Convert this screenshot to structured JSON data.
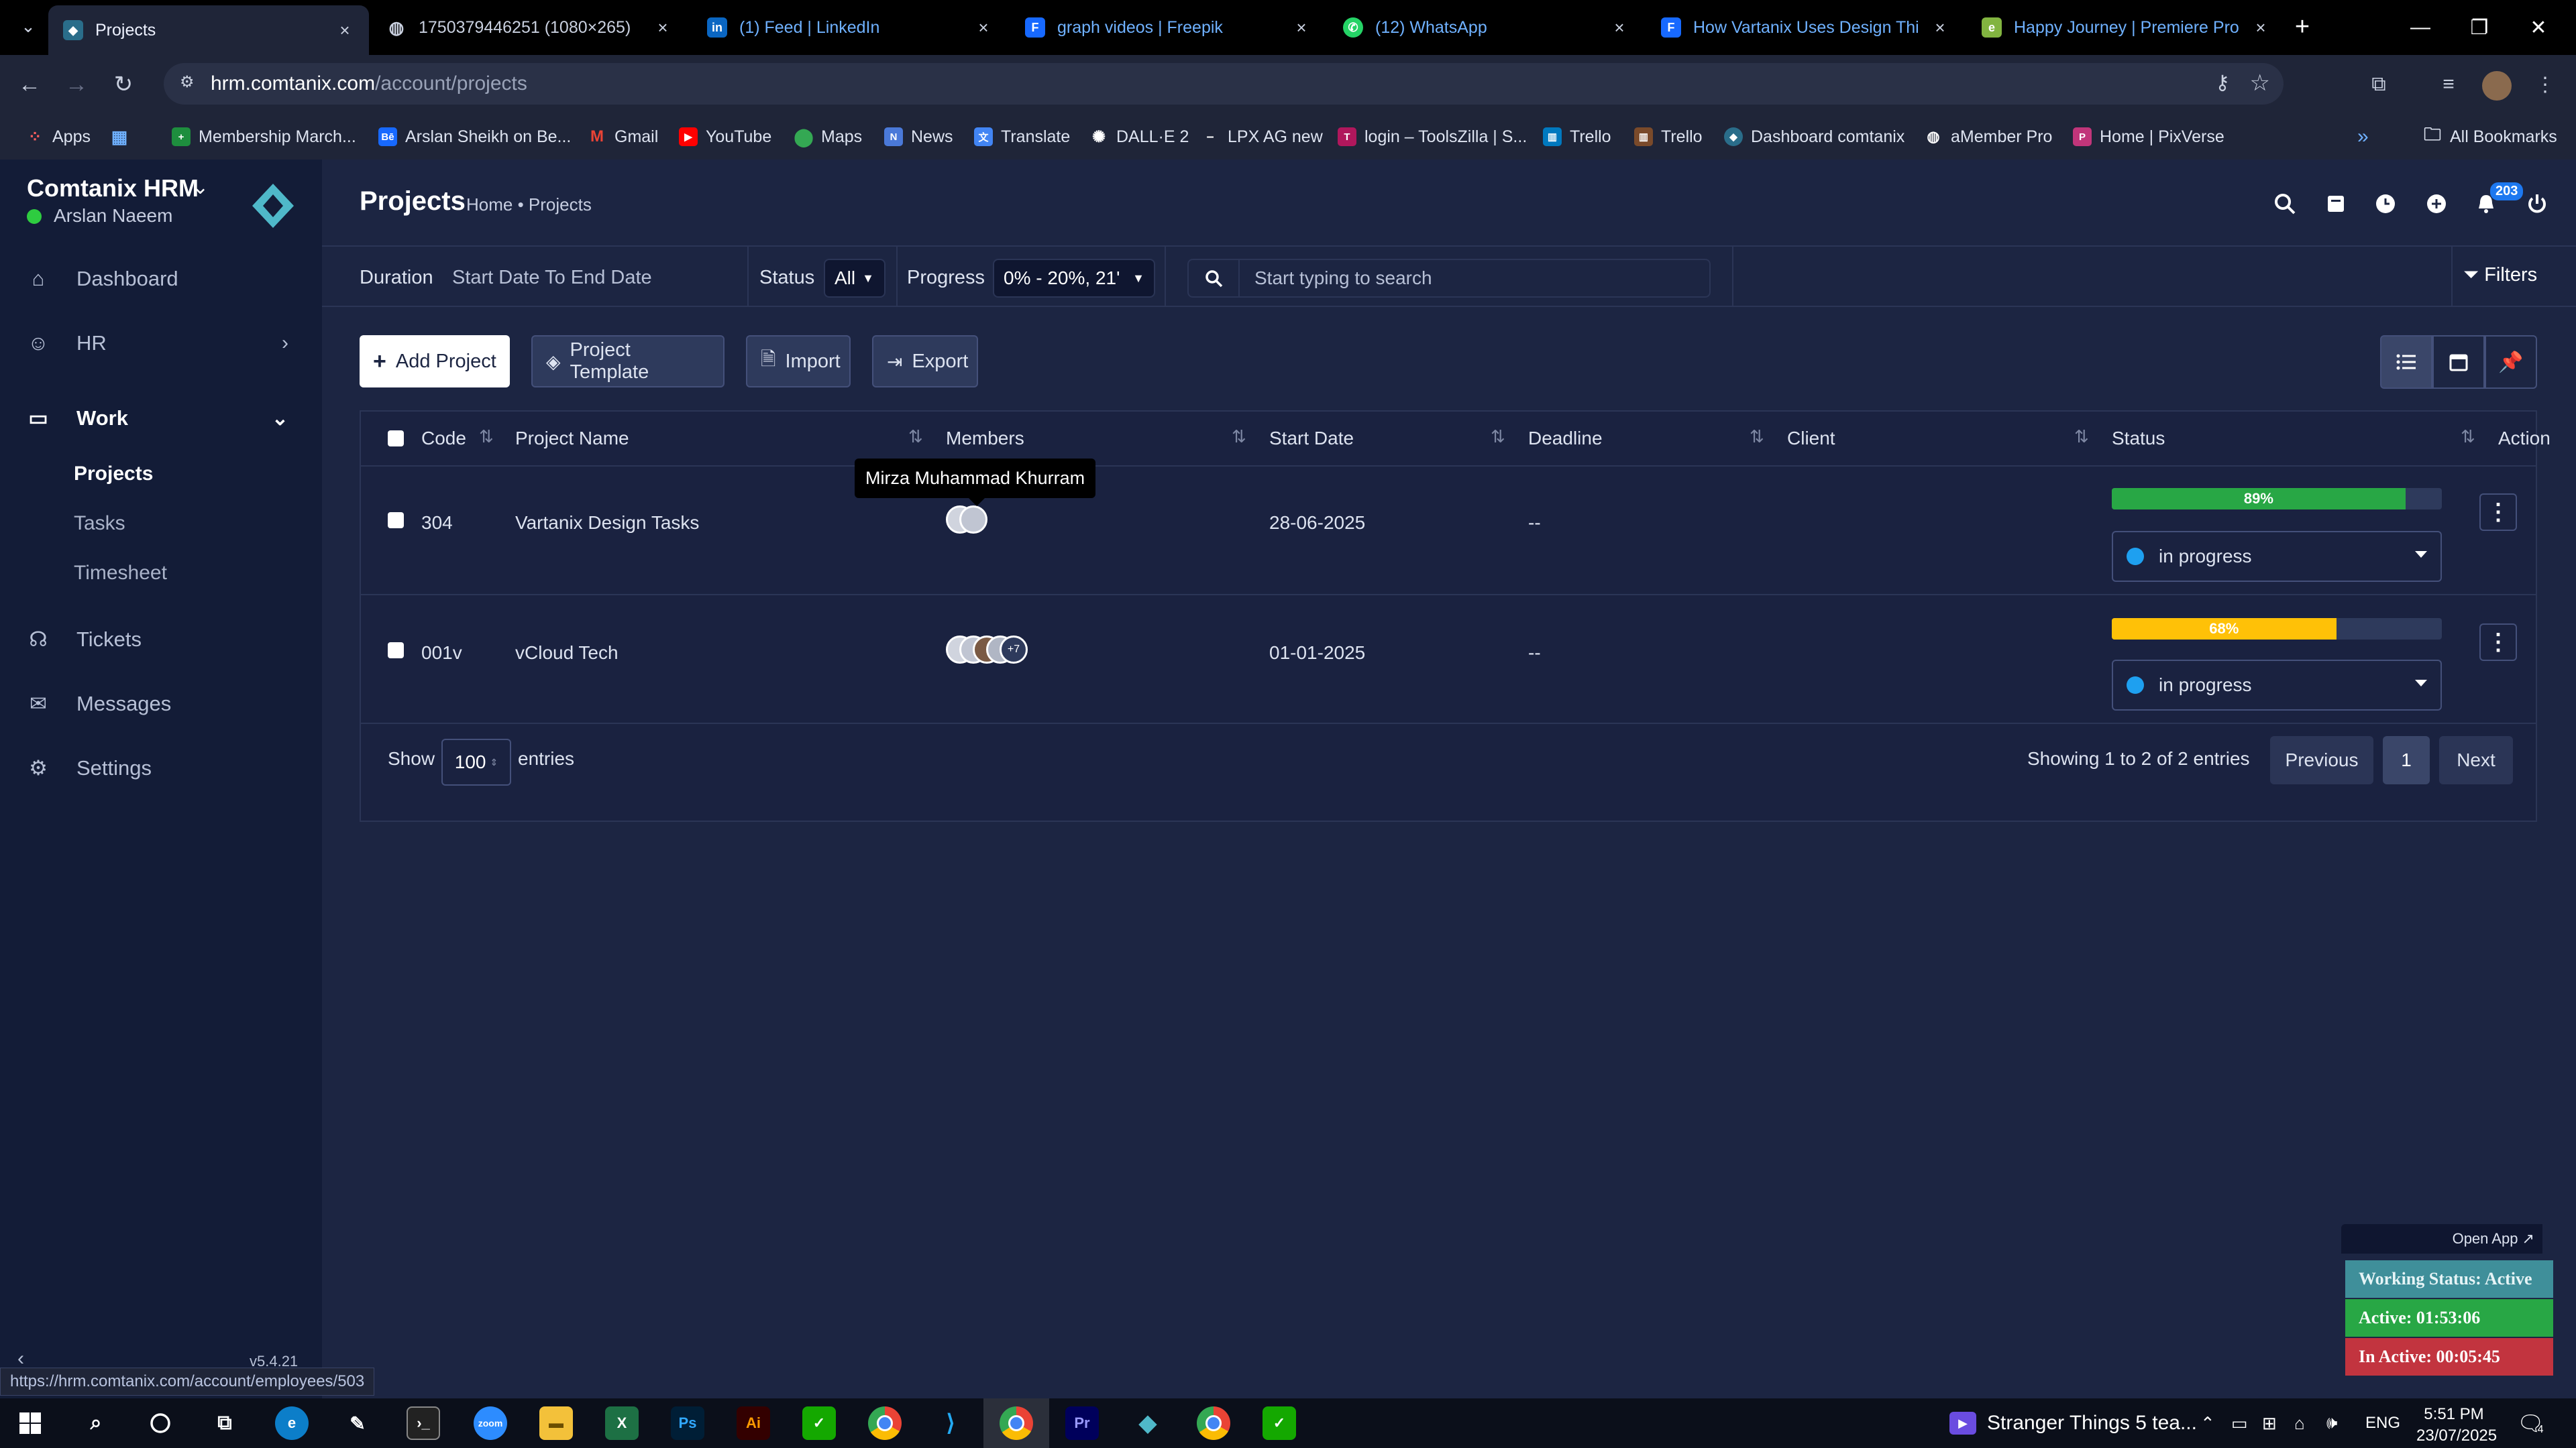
{
  "browser": {
    "tabs": [
      {
        "label": "Projects",
        "icon": "comtanix-icon",
        "active": true
      },
      {
        "label": "1750379446251 (1080×265)",
        "icon": "globe-icon"
      },
      {
        "label": "(1) Feed | LinkedIn",
        "icon": "linkedin-icon"
      },
      {
        "label": "graph videos | Freepik",
        "icon": "freepik-icon"
      },
      {
        "label": "(12) WhatsApp",
        "icon": "whatsapp-icon"
      },
      {
        "label": "How Vartanix Uses Design Thin",
        "icon": "freepik-icon"
      },
      {
        "label": "Happy Journey | Premiere Pro M",
        "icon": "envato-icon"
      }
    ],
    "url_host": "hrm.comtanix.com",
    "url_path": "/account/projects",
    "bookmarks": [
      "Apps",
      "Membership March...",
      "Arslan Sheikh on Be...",
      "Gmail",
      "YouTube",
      "Maps",
      "News",
      "Translate",
      "DALL·E 2",
      "LPX AG new",
      "login – ToolsZilla | S...",
      "Trello",
      "Trello",
      "Dashboard comtanix",
      "aMember Pro",
      "Home | PixVerse"
    ],
    "all_bookmarks": "All Bookmarks"
  },
  "sidebar": {
    "app_name": "Comtanix HRM",
    "user": "Arslan Naeem",
    "items": {
      "dashboard": "Dashboard",
      "hr": "HR",
      "work": "Work",
      "projects": "Projects",
      "tasks": "Tasks",
      "timesheet": "Timesheet",
      "tickets": "Tickets",
      "messages": "Messages",
      "settings": "Settings"
    },
    "version": "v5.4.21"
  },
  "header": {
    "title": "Projects",
    "breadcrumb": "Home • Projects",
    "notification_count": "203"
  },
  "filters": {
    "duration_label": "Duration",
    "duration_value": "Start Date To End Date",
    "status_label": "Status",
    "status_value": "All",
    "progress_label": "Progress",
    "progress_value": "0% - 20%, 21'",
    "search_placeholder": "Start typing to search",
    "filters_button": "Filters"
  },
  "actions": {
    "add_project": "Add Project",
    "project_template": "Project Template",
    "import": "Import",
    "export": "Export"
  },
  "table": {
    "columns": [
      "Code",
      "Project Name",
      "Members",
      "Start Date",
      "Deadline",
      "Client",
      "Status",
      "Action"
    ],
    "rows": [
      {
        "code": "304",
        "name": "Vartanix Design Tasks",
        "start": "28-06-2025",
        "deadline": "--",
        "client": "",
        "progress": 89,
        "progress_label": "89%",
        "progress_color": "#28a745",
        "status": "in progress",
        "extra_members": ""
      },
      {
        "code": "001v",
        "name": "vCloud Tech",
        "start": "01-01-2025",
        "deadline": "--",
        "client": "",
        "progress": 68,
        "progress_label": "68%",
        "progress_color": "#ffc107",
        "status": "in progress",
        "extra_members": "+7"
      }
    ],
    "tooltip": "Mirza Muhammad Khurram",
    "show_label": "Show",
    "show_value": "100",
    "entries_label": "entries",
    "info": "Showing 1 to 2 of 2 entries",
    "previous": "Previous",
    "page": "1",
    "next": "Next"
  },
  "widget": {
    "open_app": "Open App ↗",
    "working_status": "Working Status: Active",
    "active": "Active: 01:53:06",
    "inactive": "In Active: 00:05:45"
  },
  "status_url": "https://hrm.comtanix.com/account/employees/503",
  "taskbar": {
    "media": "Stranger Things 5 tea...",
    "lang": "ENG",
    "time": "5:51 PM",
    "date": "23/07/2025",
    "notif_count": "4"
  },
  "colors": {
    "sidebar_bg": "#131c37",
    "main_bg": "#1c2542",
    "accent": "#1ea0f0",
    "success": "#28a745",
    "warning": "#ffc107",
    "danger": "#dc3545"
  }
}
